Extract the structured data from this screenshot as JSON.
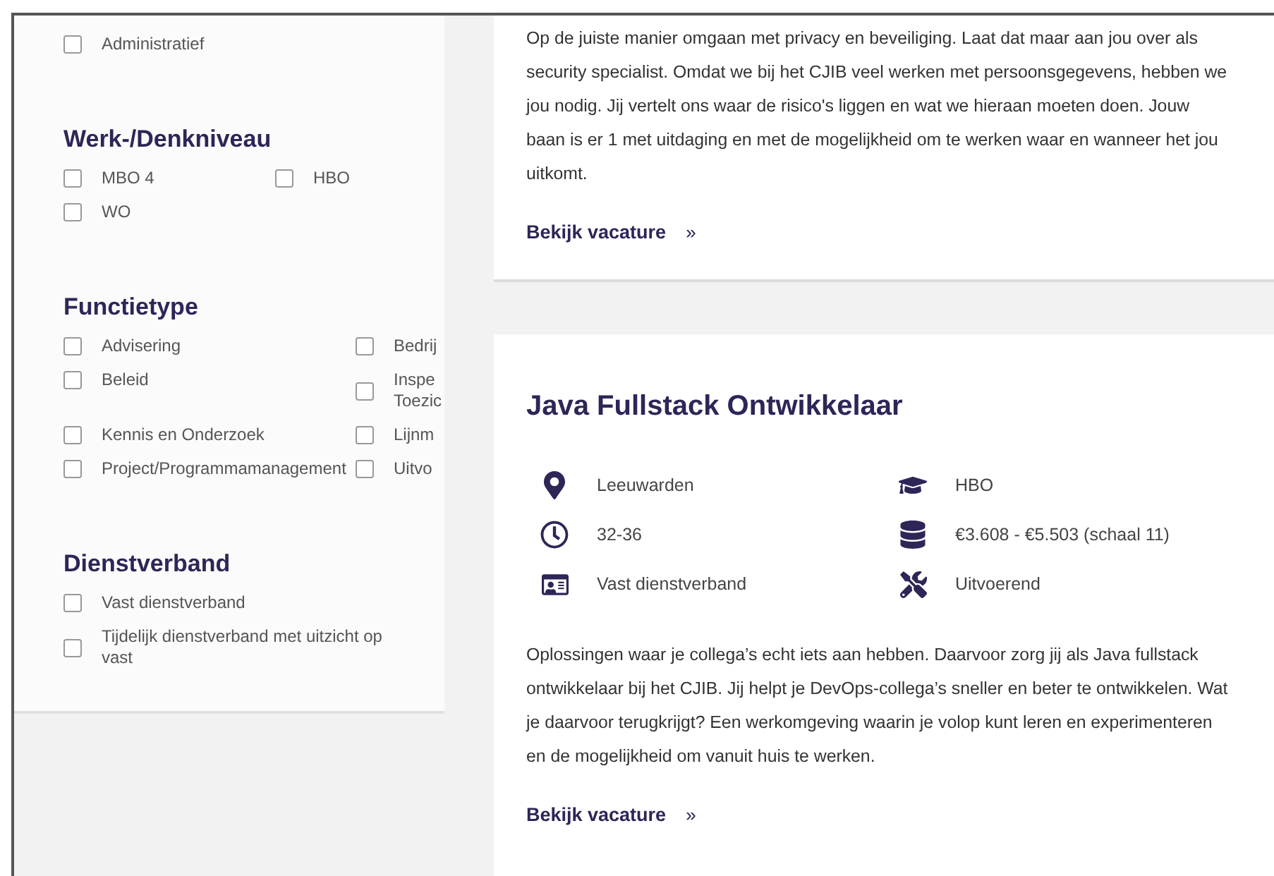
{
  "sidebar": {
    "top_items": [
      {
        "label": "Administratief",
        "checked": false
      }
    ],
    "groups": [
      {
        "title": "Werk-/Denkniveau",
        "items": [
          {
            "label": "MBO 4",
            "checked": false
          },
          {
            "label": "HBO",
            "checked": false
          },
          {
            "label": "WO",
            "checked": false
          }
        ]
      },
      {
        "title": "Functietype",
        "items": [
          {
            "label": "Advisering",
            "checked": false
          },
          {
            "label": "Bedrij",
            "checked": false
          },
          {
            "label": "Beleid",
            "checked": false
          },
          {
            "label": "Inspe Toezic",
            "checked": false
          },
          {
            "label": "Kennis en Onderzoek",
            "checked": false
          },
          {
            "label": "Lijnm",
            "checked": false
          },
          {
            "label": "Project/Programmamanagement",
            "checked": false
          },
          {
            "label": "Uitvo",
            "checked": false
          }
        ]
      },
      {
        "title": "Dienstverband",
        "items": [
          {
            "label": "Vast dienstverband",
            "checked": false
          },
          {
            "label": "Tijdelijk dienstverband met uitzicht op vast",
            "checked": false
          }
        ]
      }
    ]
  },
  "vacancies": [
    {
      "description": "Op de juiste manier omgaan met privacy en beveiliging. Laat dat maar aan jou over als security specialist. Omdat we bij het CJIB veel werken met persoonsgegevens, hebben we jou nodig. Jij vertelt ons waar de risico's liggen en wat we hieraan moeten doen. Jouw baan is er 1 met uitdaging en met de mogelijkheid om te werken waar en wanneer het jou uitkomt.",
      "link": "Bekijk vacature",
      "link_arrow": "»"
    },
    {
      "title": "Java Fullstack Ontwikkelaar",
      "facts": [
        {
          "kind": "location",
          "text": "Leeuwarden"
        },
        {
          "kind": "level",
          "text": "HBO"
        },
        {
          "kind": "hours",
          "text": "32-36"
        },
        {
          "kind": "salary",
          "text": "€3.608 - €5.503 (schaal 11)"
        },
        {
          "kind": "contract",
          "text": "Vast dienstverband"
        },
        {
          "kind": "type",
          "text": "Uitvoerend"
        }
      ],
      "description": "Oplossingen waar je collega’s echt iets aan hebben. Daarvoor zorg jij als Java fullstack ontwikkelaar bij het CJIB. Jij helpt je DevOps-collega’s sneller en beter te ontwikkelen. Wat je daarvoor terugkrijgt? Een werkomgeving waarin je volop kunt leren en experimenteren en de mogelijkheid om vanuit huis te werken.",
      "link": "Bekijk vacature",
      "link_arrow": "»"
    }
  ]
}
